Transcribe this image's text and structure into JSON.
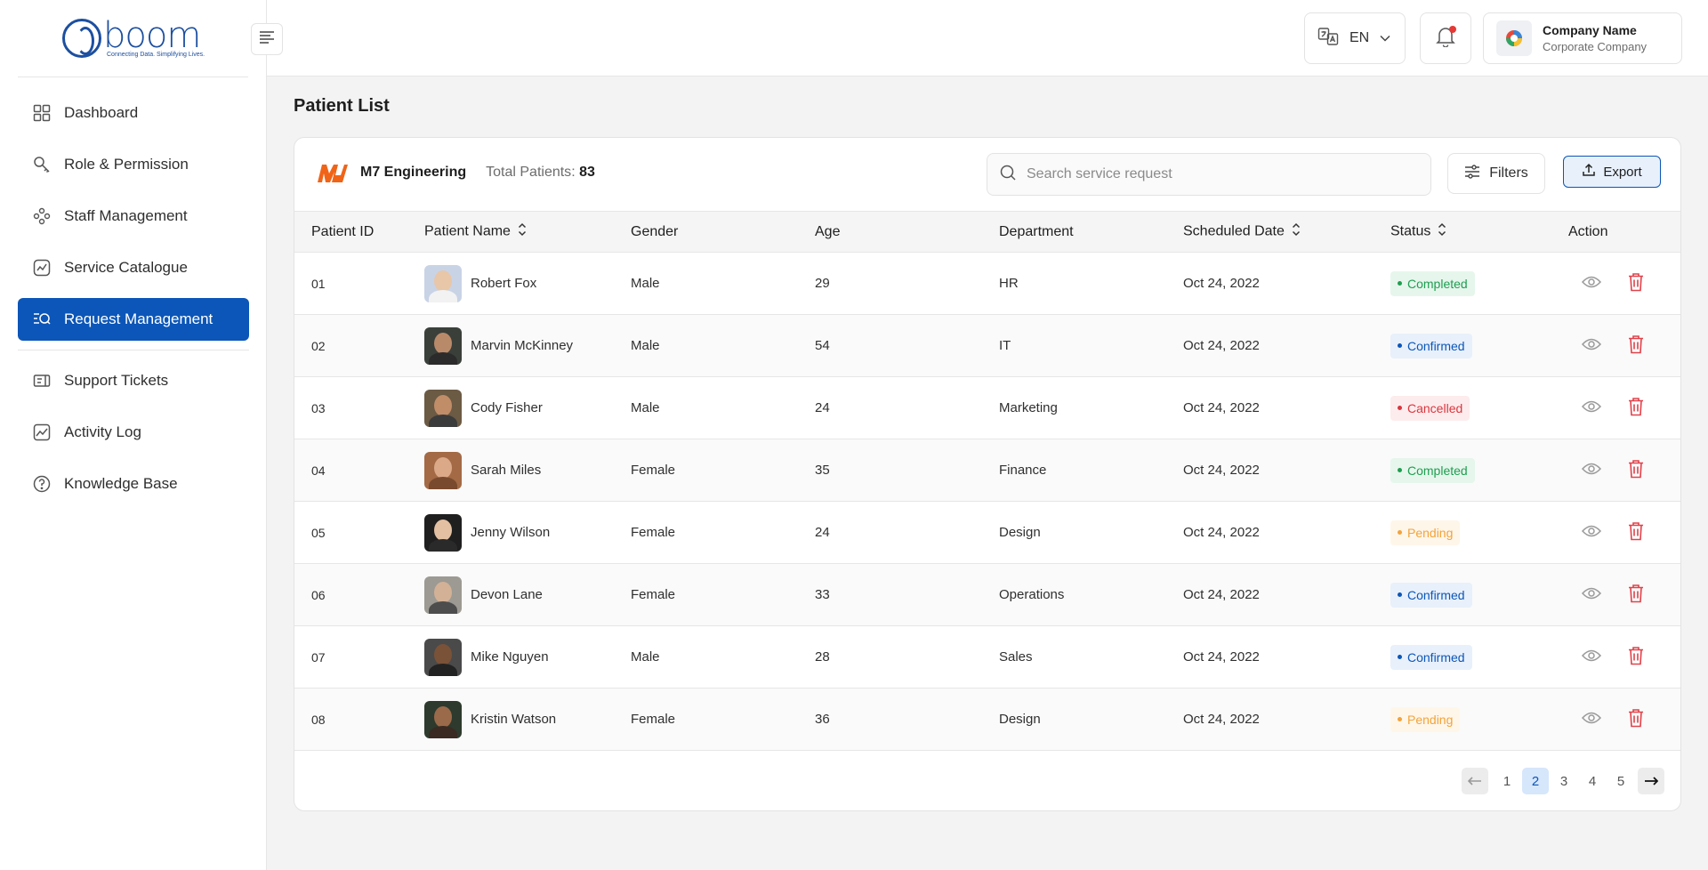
{
  "brand": {
    "name": "boom",
    "tagline": "Connecting Data. Simplifying Lives."
  },
  "sidebar": {
    "items": [
      {
        "label": "Dashboard",
        "icon": "grid-icon"
      },
      {
        "label": "Role & Permission",
        "icon": "key-icon"
      },
      {
        "label": "Staff Management",
        "icon": "users-icon"
      },
      {
        "label": "Service Catalogue",
        "icon": "catalogue-icon"
      },
      {
        "label": "Request Management",
        "icon": "list-search-icon",
        "active": true
      },
      {
        "label": "Support Tickets",
        "icon": "ticket-icon"
      },
      {
        "label": "Activity Log",
        "icon": "activity-icon"
      },
      {
        "label": "Knowledge Base",
        "icon": "help-icon"
      }
    ]
  },
  "topbar": {
    "language": "EN",
    "company_name": "Company Name",
    "company_type": "Corporate Company"
  },
  "page": {
    "title": "Patient List"
  },
  "card": {
    "org_name": "M7 Engineering",
    "total_label": "Total Patients",
    "total_value": "83",
    "search_placeholder": "Search service request",
    "filters_label": "Filters",
    "export_label": "Export"
  },
  "table": {
    "headers": {
      "id": "Patient ID",
      "name": "Patient Name",
      "gender": "Gender",
      "age": "Age",
      "department": "Department",
      "date": "Scheduled Date",
      "status": "Status",
      "action": "Action"
    },
    "rows": [
      {
        "id": "01",
        "name": "Robert Fox",
        "gender": "Male",
        "age": "29",
        "department": "HR",
        "date": "Oct 24, 2022",
        "status": "Completed",
        "status_kind": "completed"
      },
      {
        "id": "02",
        "name": "Marvin McKinney",
        "gender": "Male",
        "age": "54",
        "department": "IT",
        "date": "Oct 24, 2022",
        "status": "Confirmed",
        "status_kind": "confirmed"
      },
      {
        "id": "03",
        "name": "Cody Fisher",
        "gender": "Male",
        "age": "24",
        "department": "Marketing",
        "date": "Oct 24, 2022",
        "status": "Cancelled",
        "status_kind": "cancelled"
      },
      {
        "id": "04",
        "name": "Sarah Miles",
        "gender": "Female",
        "age": "35",
        "department": "Finance",
        "date": "Oct 24, 2022",
        "status": "Completed",
        "status_kind": "completed"
      },
      {
        "id": "05",
        "name": "Jenny Wilson",
        "gender": "Female",
        "age": "24",
        "department": "Design",
        "date": "Oct 24, 2022",
        "status": "Pending",
        "status_kind": "pending"
      },
      {
        "id": "06",
        "name": "Devon Lane",
        "gender": "Female",
        "age": "33",
        "department": "Operations",
        "date": "Oct 24, 2022",
        "status": "Confirmed",
        "status_kind": "confirmed"
      },
      {
        "id": "07",
        "name": "Mike Nguyen",
        "gender": "Male",
        "age": "28",
        "department": "Sales",
        "date": "Oct 24, 2022",
        "status": "Confirmed",
        "status_kind": "confirmed"
      },
      {
        "id": "08",
        "name": "Kristin Watson",
        "gender": "Female",
        "age": "36",
        "department": "Design",
        "date": "Oct 24, 2022",
        "status": "Pending",
        "status_kind": "pending"
      }
    ]
  },
  "pagination": {
    "pages": [
      "1",
      "2",
      "3",
      "4",
      "5"
    ],
    "current": "2"
  },
  "colors": {
    "primary": "#0b56b8",
    "completed": "#1e9e50",
    "cancelled": "#d9363e",
    "pending": "#f2a33a",
    "delete": "#e0424a"
  }
}
